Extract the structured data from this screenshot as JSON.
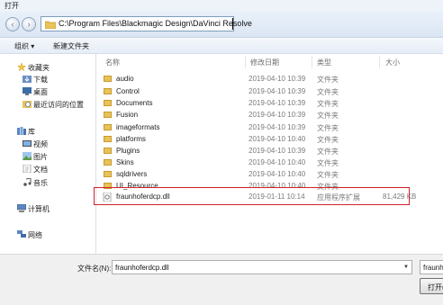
{
  "window": {
    "title": "打开"
  },
  "address": {
    "path": "C:\\Program Files\\Blackmagic Design\\DaVinci Resolve"
  },
  "toolbar": {
    "organize": "组织 ▾",
    "new_folder": "新建文件夹"
  },
  "sidebar": {
    "favorites": "收藏夹",
    "downloads": "下载",
    "desktop": "桌面",
    "recent": "最近访问的位置",
    "libraries": "库",
    "videos": "视频",
    "pictures": "图片",
    "documents": "文档",
    "music": "音乐",
    "computer": "计算机",
    "network": "网络"
  },
  "columns": {
    "name": "名称",
    "date": "修改日期",
    "type": "类型",
    "size": "大小"
  },
  "files": [
    {
      "name": "audio",
      "date": "2019-04-10 10:39",
      "type": "文件夹",
      "size": ""
    },
    {
      "name": "Control",
      "date": "2019-04-10 10:39",
      "type": "文件夹",
      "size": ""
    },
    {
      "name": "Documents",
      "date": "2019-04-10 10:39",
      "type": "文件夹",
      "size": ""
    },
    {
      "name": "Fusion",
      "date": "2019-04-10 10:39",
      "type": "文件夹",
      "size": ""
    },
    {
      "name": "imageformats",
      "date": "2019-04-10 10:39",
      "type": "文件夹",
      "size": ""
    },
    {
      "name": "platforms",
      "date": "2019-04-10 10:40",
      "type": "文件夹",
      "size": ""
    },
    {
      "name": "Plugins",
      "date": "2019-04-10 10:39",
      "type": "文件夹",
      "size": ""
    },
    {
      "name": "Skins",
      "date": "2019-04-10 10:40",
      "type": "文件夹",
      "size": ""
    },
    {
      "name": "sqldrivers",
      "date": "2019-04-10 10:40",
      "type": "文件夹",
      "size": ""
    },
    {
      "name": "UI_Resource",
      "date": "2019-04-10 10:40",
      "type": "文件夹",
      "size": ""
    },
    {
      "name": "fraunhoferdcp.dll",
      "date": "2019-01-11 10:14",
      "type": "应用程序扩展",
      "size": "81,429 KB"
    }
  ],
  "footer": {
    "filename_label": "文件名(N):",
    "filename_value": "fraunhoferdcp.dll",
    "filter_value": "fraunh",
    "open_label": "打开(O)"
  }
}
